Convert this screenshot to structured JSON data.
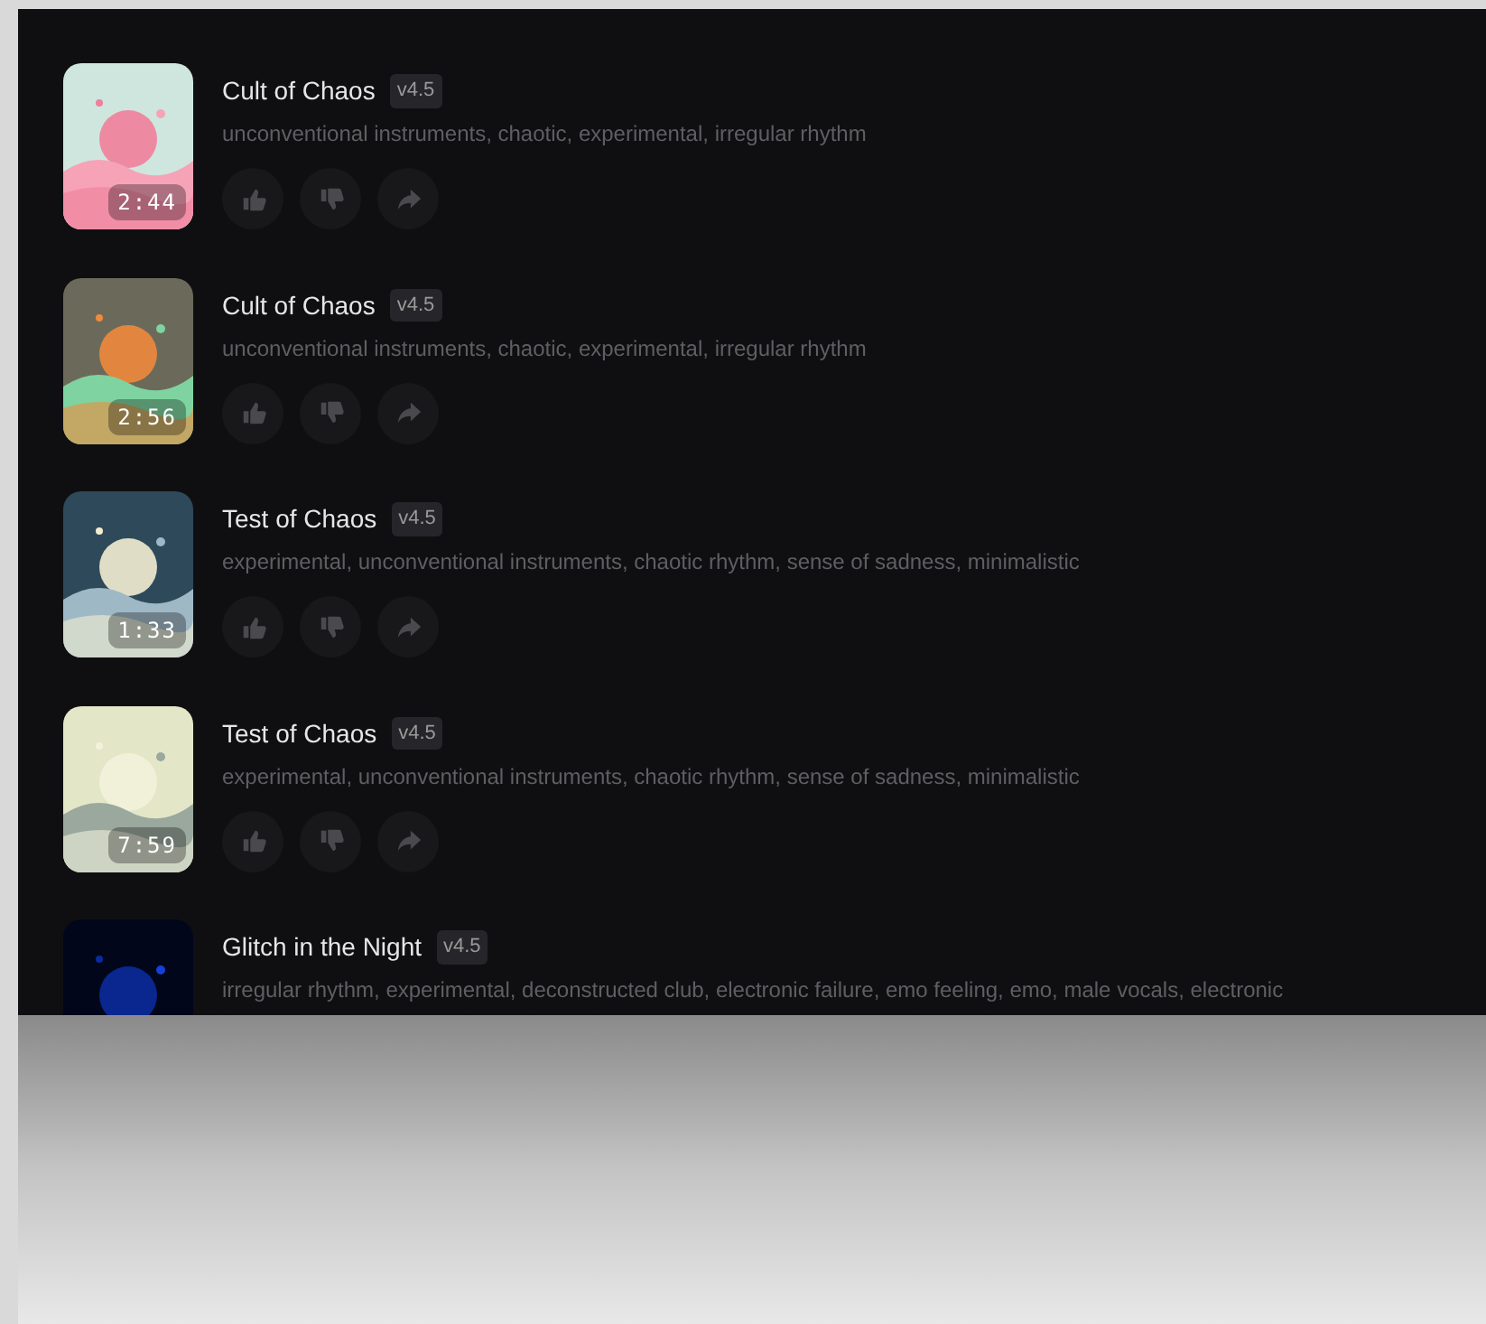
{
  "songs": [
    {
      "title": "Cult of Chaos",
      "version": "v4.5",
      "tags": "unconventional instruments, chaotic, experimental, irregular rhythm",
      "duration": "2:44",
      "actions": true
    },
    {
      "title": "Cult of Chaos",
      "version": "v4.5",
      "tags": "unconventional instruments, chaotic, experimental, irregular rhythm",
      "duration": "2:56",
      "actions": true
    },
    {
      "title": "Test of Chaos",
      "version": "v4.5",
      "tags": "experimental, unconventional instruments, chaotic rhythm, sense of sadness, minimalistic",
      "duration": "1:33",
      "actions": true
    },
    {
      "title": "Test of Chaos",
      "version": "v4.5",
      "tags": "experimental, unconventional instruments, chaotic rhythm, sense of sadness, minimalistic",
      "duration": "7:59",
      "actions": true
    },
    {
      "title": "Glitch in the Night",
      "version": "v4.5",
      "tags": "irregular rhythm, experimental, deconstructed club, electronic failure, emo feeling, emo, male vocals, electronic"
    }
  ]
}
